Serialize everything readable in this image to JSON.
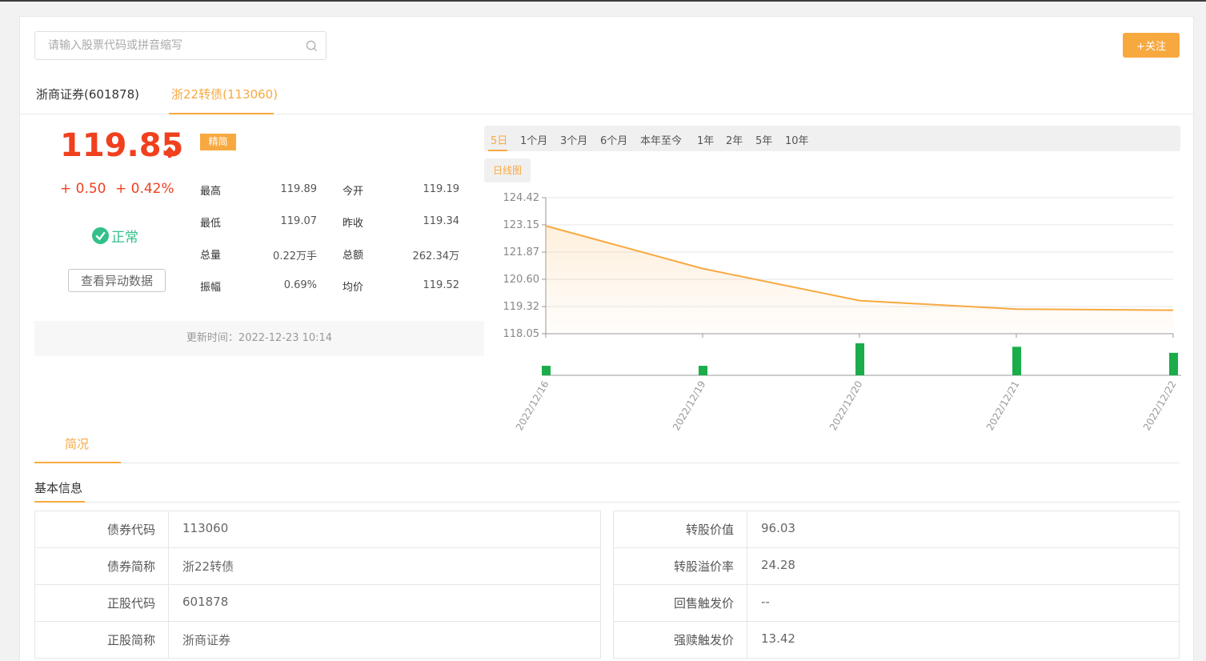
{
  "search": {
    "placeholder": "请输入股票代码或拼音缩写"
  },
  "follow_button": "+关注",
  "tabs": [
    {
      "label": "浙商证券(601878)"
    },
    {
      "label": "浙22转债(113060)"
    }
  ],
  "quote": {
    "price": "119.85",
    "change": "+ 0.50",
    "change_pct": "+ 0.42%",
    "status": "正常",
    "abnormal_button": "查看异动数据",
    "tag": "精简",
    "stats": [
      {
        "label": "最高",
        "value": "119.89"
      },
      {
        "label": "今开",
        "value": "119.19"
      },
      {
        "label": "最低",
        "value": "119.07"
      },
      {
        "label": "昨收",
        "value": "119.34"
      },
      {
        "label": "总量",
        "value": "0.22万手"
      },
      {
        "label": "总额",
        "value": "262.34万"
      },
      {
        "label": "振幅",
        "value": "0.69%"
      },
      {
        "label": "均价",
        "value": "119.52"
      }
    ],
    "update_time": "更新时间：2022-12-23 10:14"
  },
  "periods": [
    "5日",
    "1个月",
    "3个月",
    "6个月",
    "本年至今",
    "1年",
    "2年",
    "5年",
    "10年"
  ],
  "kline_button": "日线图",
  "colors": {
    "accent": "#f7a940",
    "up": "#f0401e",
    "volume": "#1aad4a",
    "status": "#34c08a"
  },
  "chart_data": {
    "type": "line",
    "x": [
      "2022/12/16",
      "2022/12/19",
      "2022/12/20",
      "2022/12/21",
      "2022/12/22"
    ],
    "y_ticks": [
      "124.42",
      "123.15",
      "121.87",
      "120.60",
      "119.32",
      "118.05"
    ],
    "ylim": [
      118.05,
      124.42
    ],
    "series": [
      {
        "values": [
          123.1,
          121.1,
          119.6,
          119.2,
          119.15
        ]
      }
    ],
    "volume": [
      11,
      11,
      37,
      33,
      26
    ],
    "grid": true
  },
  "overview": {
    "tab": "简况",
    "section_title": "基本信息",
    "left_rows": [
      {
        "key": "债券代码",
        "value": "113060"
      },
      {
        "key": "债券简称",
        "value": "浙22转债"
      },
      {
        "key": "正股代码",
        "value": "601878"
      },
      {
        "key": "正股简称",
        "value": "浙商证券"
      }
    ],
    "right_rows": [
      {
        "key": "转股价值",
        "value": "96.03"
      },
      {
        "key": "转股溢价率",
        "value": "24.28"
      },
      {
        "key": "回售触发价",
        "value": "--"
      },
      {
        "key": "强赎触发价",
        "value": "13.42"
      }
    ]
  }
}
